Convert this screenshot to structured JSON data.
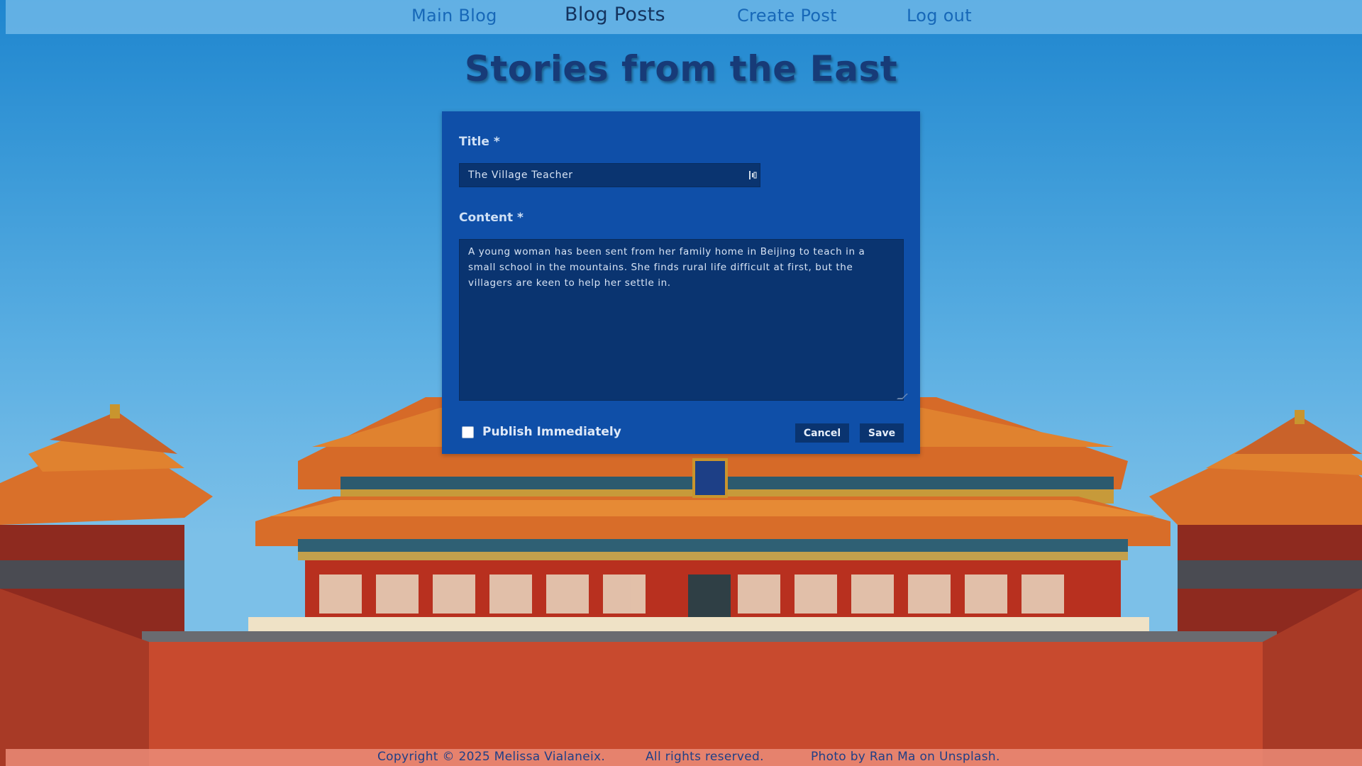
{
  "nav": {
    "main_blog": "Main Blog",
    "blog_posts": "Blog Posts",
    "create_post": "Create Post",
    "log_out": "Log out"
  },
  "site_title": "Stories from the East",
  "form": {
    "title_label": "Title *",
    "title_value": "The Village Teacher",
    "content_label": "Content *",
    "content_value": "A young woman has been sent from her family home in Beijing to teach in a small school in the mountains. She finds rural life difficult at first, but the villagers are keen to help her settle in.",
    "publish_label": "Publish Immediately",
    "publish_checked": false,
    "cancel_label": "Cancel",
    "save_label": "Save"
  },
  "footer": {
    "copyright": "Copyright © 2025 Melissa Vialaneix.",
    "rights": "All rights reserved.",
    "photo_credit": "Photo by Ran Ma on Unsplash."
  },
  "colors": {
    "card_bg": "#0f4fa8",
    "input_bg": "#0a3470",
    "title_color": "#173b78",
    "nav_link": "#1768b8",
    "wall_red": "#c84a2e",
    "roof_orange": "#e0782d"
  }
}
